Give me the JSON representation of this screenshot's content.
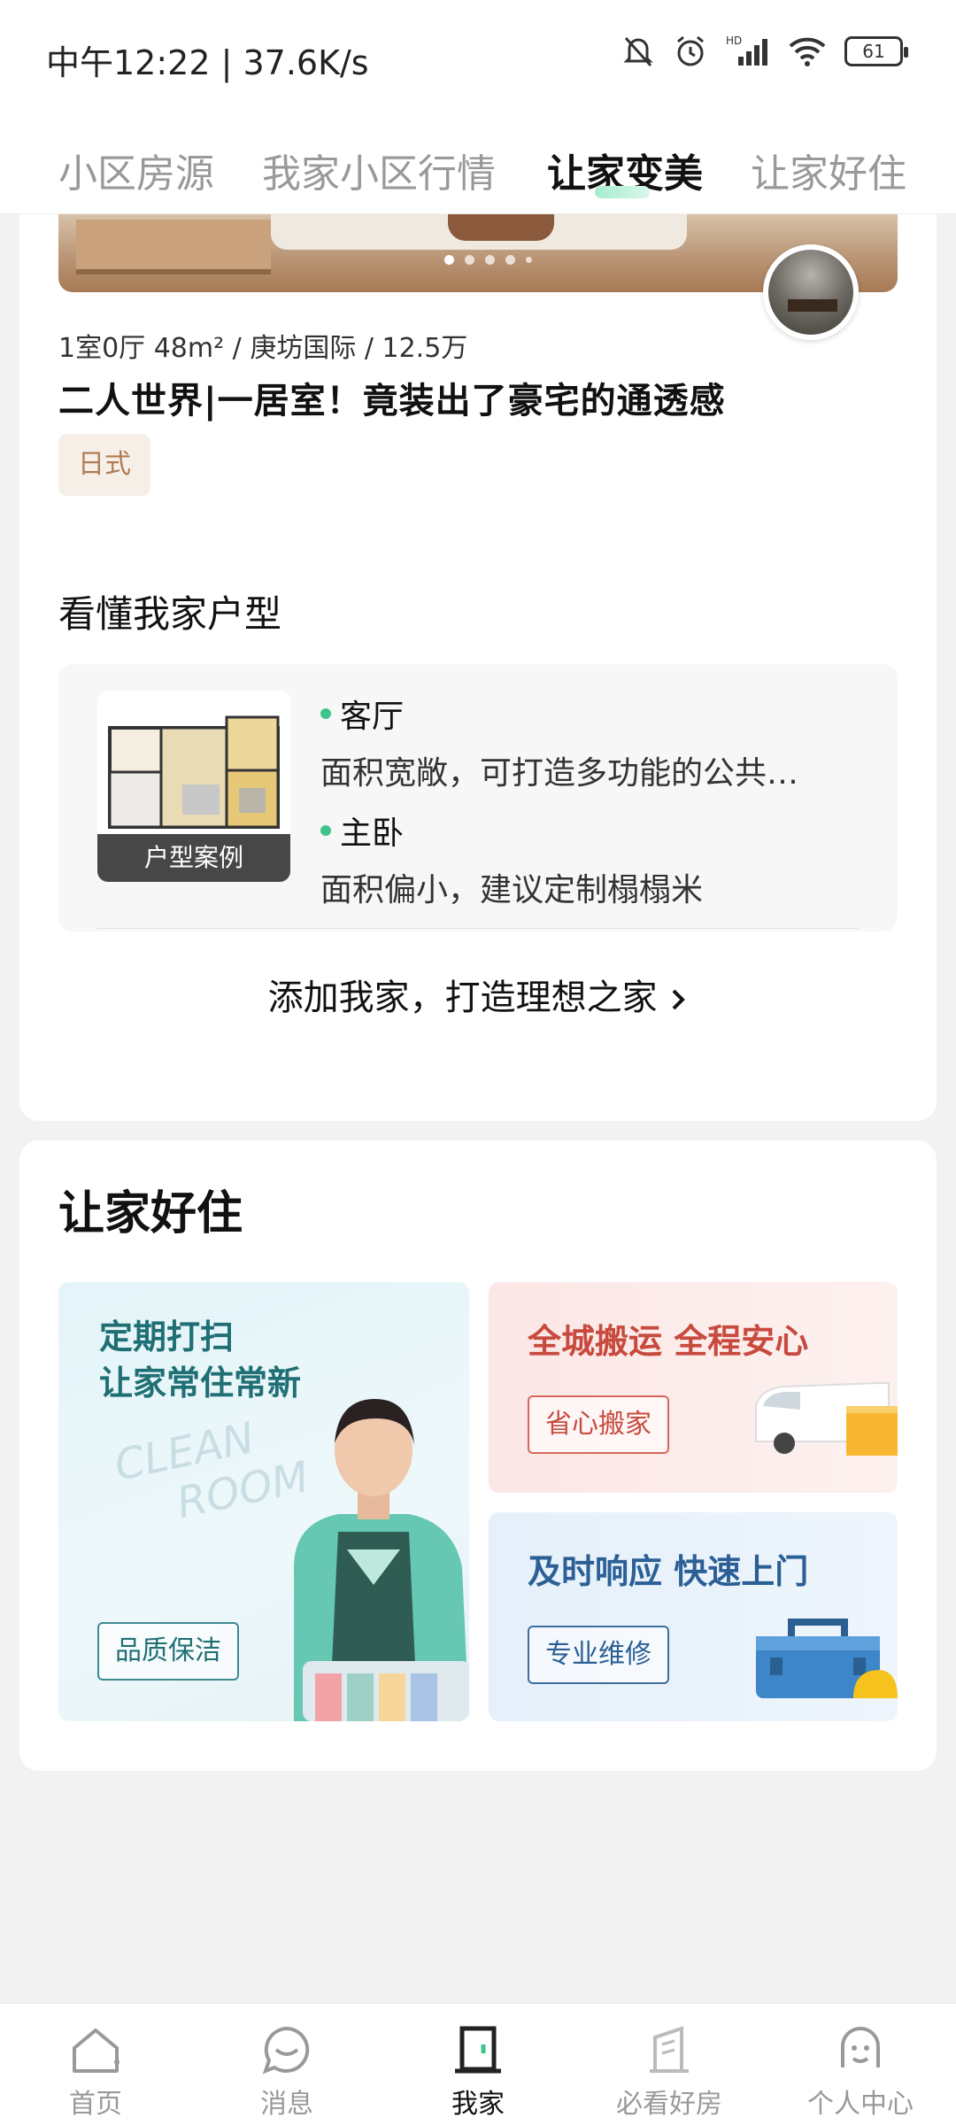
{
  "status_bar": {
    "time_speed": "中午12:22 | 37.6K/s",
    "battery": "61",
    "icons": [
      "bell-mute-icon",
      "alarm-icon",
      "hd-signal-icon",
      "wifi-icon",
      "battery-icon"
    ]
  },
  "top_tabs": [
    {
      "label": "小区房源",
      "active": false
    },
    {
      "label": "我家小区行情",
      "active": false
    },
    {
      "label": "让家变美",
      "active": true
    },
    {
      "label": "让家好住",
      "active": false
    }
  ],
  "design_case": {
    "meta": "1室0厅 48m² / 庚坊国际 / 12.5万",
    "title": "二人世界|一居室！竟装出了豪宅的通透感",
    "style_tag": "日式",
    "carousel_count": 5
  },
  "floorplan_section": {
    "title": "看懂我家户型",
    "thumb_label": "户型案例",
    "rooms": [
      {
        "name": "客厅",
        "desc": "面积宽敞，可打造多功能的公共…"
      },
      {
        "name": "主卧",
        "desc": "面积偏小，建议定制榻榻米"
      }
    ],
    "cta": "添加我家，打造理想之家"
  },
  "services": {
    "title": "让家好住",
    "cleaning": {
      "line1": "定期打扫",
      "line2": "让家常住常新",
      "ghost1": "CLEAN",
      "ghost2": "ROOM",
      "button": "品质保洁"
    },
    "moving": {
      "headline": "全城搬运 全程安心",
      "button": "省心搬家"
    },
    "repair": {
      "headline": "及时响应 快速上门",
      "button": "专业维修"
    }
  },
  "bottom_nav": [
    {
      "label": "首页",
      "icon": "home-icon",
      "active": false
    },
    {
      "label": "消息",
      "icon": "message-icon",
      "active": false
    },
    {
      "label": "我家",
      "icon": "door-icon",
      "active": true
    },
    {
      "label": "必看好房",
      "icon": "building-icon",
      "active": false
    },
    {
      "label": "个人中心",
      "icon": "profile-icon",
      "active": false
    }
  ],
  "colors": {
    "accent_green": "#3ec48a",
    "clean_teal": "#1f6f74",
    "move_red": "#c84a3e",
    "repair_blue": "#2b5f95"
  }
}
